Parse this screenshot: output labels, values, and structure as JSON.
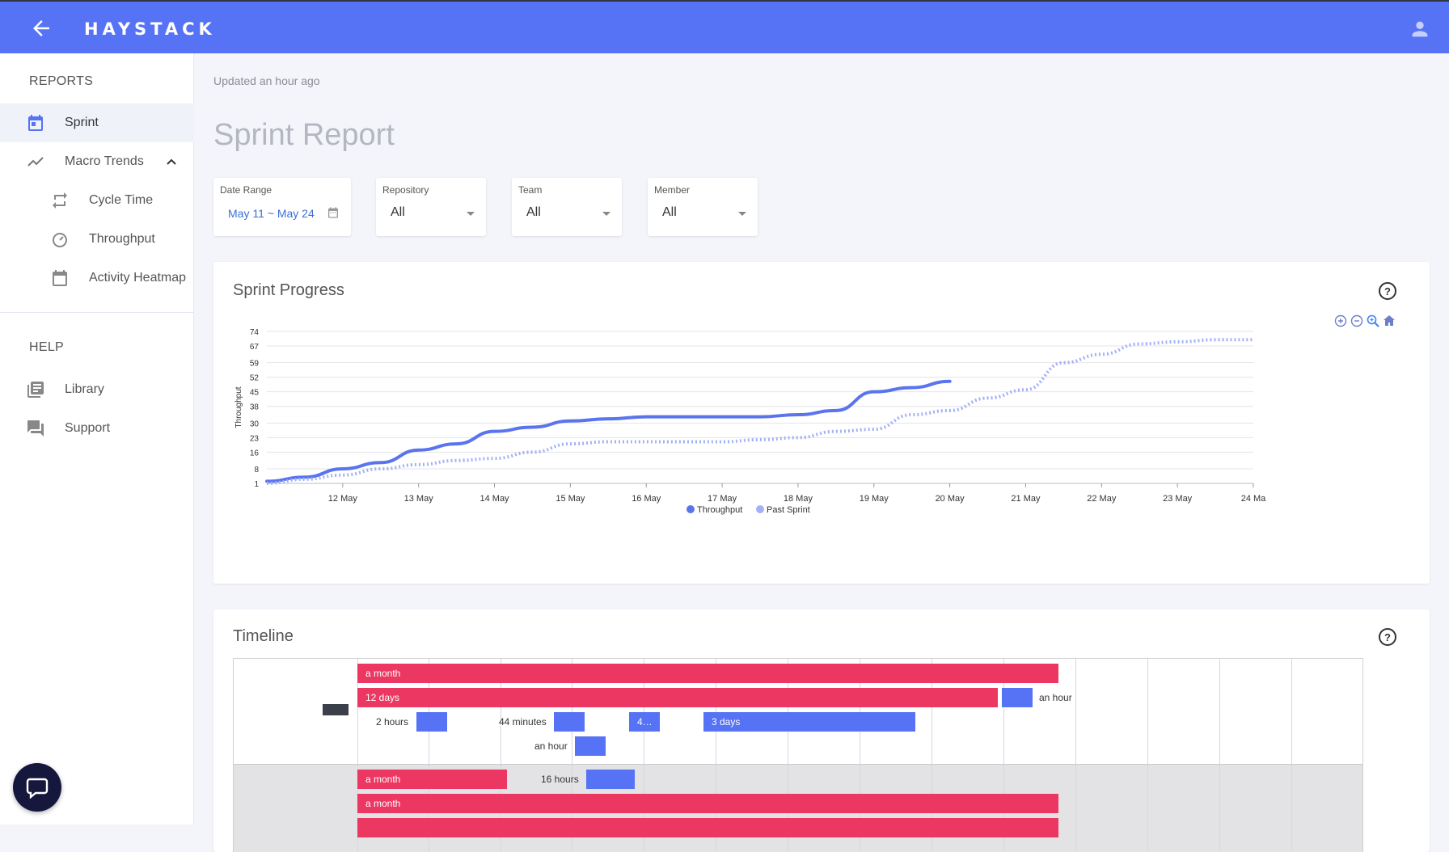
{
  "header": {
    "logo_text": "HAYSTACK",
    "back_icon": "arrow-left-icon",
    "user_icon": "account-icon",
    "bar_color": "#5672f5"
  },
  "sidebar": {
    "reports_title": "REPORTS",
    "help_title": "HELP",
    "items": [
      {
        "label": "Sprint",
        "icon": "calendar-icon",
        "active": true
      },
      {
        "label": "Macro Trends",
        "icon": "trending-icon",
        "expanded": true
      },
      {
        "label": "Cycle Time",
        "icon": "repeat-icon"
      },
      {
        "label": "Throughput",
        "icon": "speedometer-icon"
      },
      {
        "label": "Activity Heatmap",
        "icon": "calendar-blank-icon"
      }
    ],
    "help_items": [
      {
        "label": "Library",
        "icon": "library-icon"
      },
      {
        "label": "Support",
        "icon": "chat-bubbles-icon"
      }
    ]
  },
  "main": {
    "updated": "Updated an hour ago",
    "title": "Sprint Report",
    "filters": {
      "date_range": {
        "label": "Date Range",
        "value": "May 11 ~ May 24"
      },
      "repository": {
        "label": "Repository",
        "value": "All"
      },
      "team": {
        "label": "Team",
        "value": "All"
      },
      "member": {
        "label": "Member",
        "value": "All"
      }
    }
  },
  "sprint_progress": {
    "title": "Sprint Progress",
    "tools": [
      "zoom-in-icon",
      "zoom-out-icon",
      "zoom-select-icon",
      "home-icon"
    ]
  },
  "chart_data": {
    "type": "line",
    "title": "",
    "xlabel": "",
    "ylabel": "Throughput",
    "y_ticks": [
      1,
      8,
      16,
      23,
      30,
      38,
      45,
      52,
      59,
      67,
      74
    ],
    "ylim": [
      1,
      74
    ],
    "x_ticks": [
      "12 May",
      "13 May",
      "14 May",
      "15 May",
      "16 May",
      "17 May",
      "18 May",
      "19 May",
      "20 May",
      "21 May",
      "22 May",
      "23 May",
      "24 Ma"
    ],
    "x": [
      0,
      0.5,
      1,
      1.5,
      2,
      2.5,
      3,
      3.5,
      4,
      4.5,
      5,
      5.5,
      6,
      6.5,
      7,
      7.5,
      8,
      8.5,
      9,
      9.5,
      10,
      10.5,
      11,
      11.5,
      12,
      12.5,
      13
    ],
    "series": [
      {
        "name": "Throughput",
        "color": "#5a74ee",
        "dashed": false,
        "values": [
          2,
          4,
          8,
          11,
          17,
          20,
          26,
          28,
          31,
          32,
          33,
          33,
          33,
          33,
          34,
          36,
          45,
          47,
          50,
          null,
          null,
          null,
          null,
          null,
          null,
          null,
          null
        ]
      },
      {
        "name": "Past Sprint",
        "color": "#a3b2f4",
        "dashed": true,
        "values": [
          1,
          3,
          5,
          8,
          10,
          12,
          13,
          16,
          20,
          21,
          21,
          21,
          21,
          22,
          23,
          26,
          27,
          34,
          36,
          42,
          46,
          59,
          63,
          68,
          69,
          70,
          70
        ]
      }
    ],
    "legend": "bottom-center",
    "grid": true
  },
  "timeline": {
    "title": "Timeline",
    "rows": [
      {
        "bars": [
          {
            "label": "a month",
            "color": "red"
          }
        ]
      },
      {
        "bars": [
          {
            "label": "12 days",
            "color": "red"
          },
          {
            "label": "",
            "color": "blue",
            "side_label": "an hour"
          }
        ]
      },
      {
        "bars": [
          {
            "label": "",
            "color": "blue",
            "side_label": "2 hours"
          },
          {
            "label": "",
            "color": "blue",
            "side_label": "44 minutes"
          },
          {
            "label": "4…",
            "color": "blue"
          },
          {
            "label": "3 days",
            "color": "blue"
          }
        ]
      },
      {
        "bars": [
          {
            "label": "",
            "color": "blue",
            "side_label": "an hour"
          }
        ]
      },
      {
        "bars": [
          {
            "label": "a month",
            "color": "red"
          },
          {
            "label": "",
            "color": "blue",
            "side_label": "16 hours"
          }
        ]
      },
      {
        "bars": [
          {
            "label": "a month",
            "color": "red"
          }
        ]
      }
    ]
  },
  "chat_icon": "chat-icon"
}
